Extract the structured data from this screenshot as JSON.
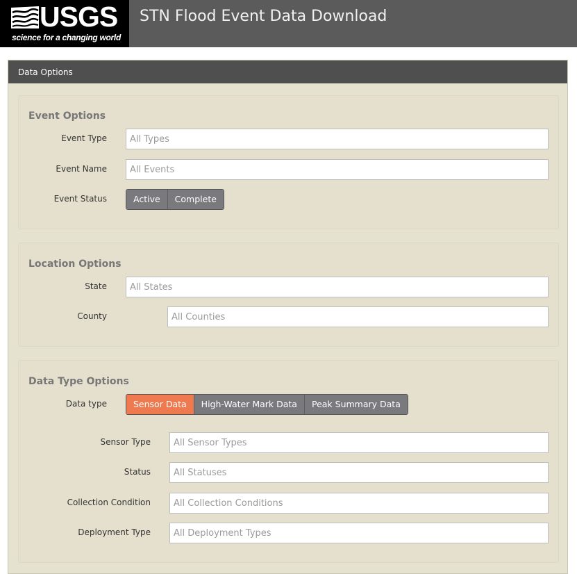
{
  "header": {
    "logo_text": "USGS",
    "logo_tagline": "science for a changing world",
    "app_title": "STN Flood Event Data Download"
  },
  "panel": {
    "title": "Data Options"
  },
  "event_options": {
    "title": "Event Options",
    "event_type": {
      "label": "Event Type",
      "placeholder": "All Types"
    },
    "event_name": {
      "label": "Event Name",
      "placeholder": "All Events"
    },
    "event_status": {
      "label": "Event Status",
      "options": [
        "Active",
        "Complete"
      ],
      "selected": ""
    }
  },
  "location_options": {
    "title": "Location Options",
    "state": {
      "label": "State",
      "placeholder": "All States"
    },
    "county": {
      "label": "County",
      "placeholder": "All Counties"
    }
  },
  "data_type_options": {
    "title": "Data Type Options",
    "data_type": {
      "label": "Data type",
      "options": [
        "Sensor Data",
        "High-Water Mark Data",
        "Peak Summary Data"
      ],
      "selected": "Sensor Data"
    },
    "sensor_type": {
      "label": "Sensor Type",
      "placeholder": "All Sensor Types"
    },
    "status": {
      "label": "Status",
      "placeholder": "All Statuses"
    },
    "collection_condition": {
      "label": "Collection Condition",
      "placeholder": "All Collection Conditions"
    },
    "deployment_type": {
      "label": "Deployment Type",
      "placeholder": "All Deployment Types"
    }
  },
  "colors": {
    "header_bg": "#5b5b5b",
    "panel_bg": "#e6e2d0",
    "button_bg": "#7a797d",
    "button_active_bg": "#f07a4f"
  }
}
